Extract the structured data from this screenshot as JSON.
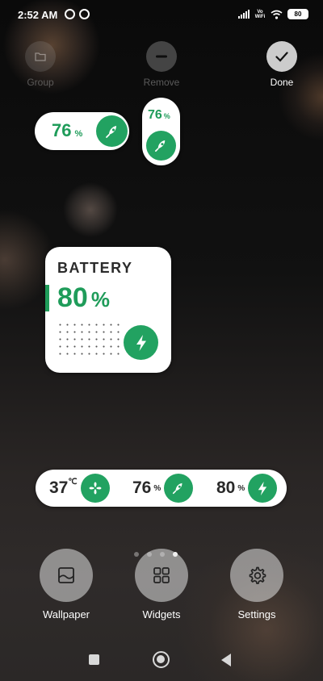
{
  "status_bar": {
    "time": "2:52 AM",
    "network_label": "Vo WiFi",
    "battery": "80"
  },
  "edit_actions": {
    "group": "Group",
    "remove": "Remove",
    "done": "Done"
  },
  "widgets": {
    "small_horizontal": {
      "value": "76",
      "unit": "%"
    },
    "small_vertical": {
      "value": "76",
      "unit": "%"
    },
    "battery_card": {
      "title": "BATTERY",
      "value": "80",
      "unit": "%"
    },
    "strip": {
      "temperature": {
        "value": "37",
        "unit": "℃"
      },
      "storage": {
        "value": "76",
        "unit": "%"
      },
      "battery": {
        "value": "80",
        "unit": "%"
      }
    }
  },
  "pager": {
    "count": 4,
    "active_index": 3
  },
  "bottom_tools": {
    "wallpaper": "Wallpaper",
    "widgets": "Widgets",
    "settings": "Settings"
  },
  "colors": {
    "accent": "#1f9c5a",
    "background": "#111111"
  }
}
